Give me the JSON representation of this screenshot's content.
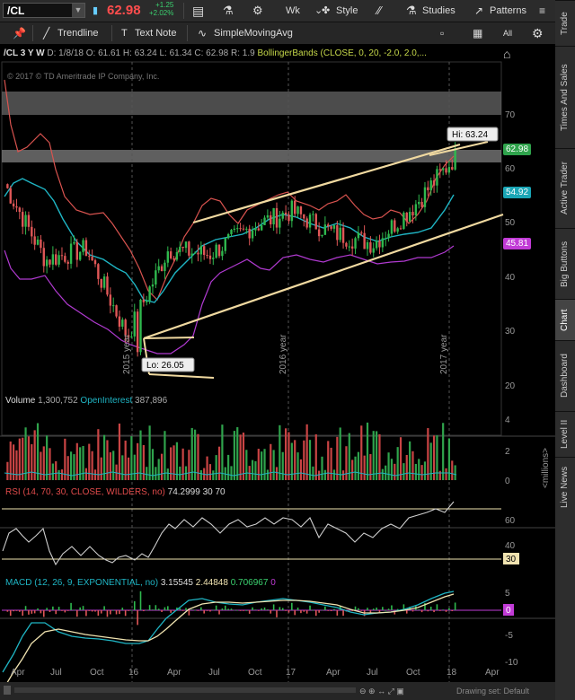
{
  "symbol": "/CL",
  "last_price": "62.98",
  "change": "+1.25",
  "change_pct": "+2.02%",
  "toolbar": {
    "period": "Wk",
    "style": "Style",
    "studies": "Studies",
    "patterns": "Patterns"
  },
  "drawing_tools": {
    "trendline": "Trendline",
    "text_note": "Text Note",
    "sma": "SimpleMovingAvg",
    "all": "All"
  },
  "chart_header": {
    "title": "/CL 3 Y W",
    "d": "D: 1/8/18",
    "o": "O: 61.61",
    "h": "H: 63.24",
    "l": "L: 61.34",
    "c": "C: 62.98",
    "r": "R: 1.9",
    "study": "BollingerBands (CLOSE, 0, 20, -2.0, 2.0,..."
  },
  "copyright": "© 2017 © TD Ameritrade IP Company, Inc.",
  "price_axis": [
    "70",
    "60",
    "50",
    "40",
    "30",
    "20"
  ],
  "price_badges": {
    "last": "62.98",
    "mid": "54.92",
    "lower": "45.81",
    "last_color": "#2fa34c",
    "mid_color": "#1aa5b5",
    "lower_color": "#c13bd6"
  },
  "annotations": {
    "hi": "Hi: 63.24",
    "lo": "Lo: 26.05",
    "year_2015": "2015 year",
    "year_2016": "2016 year",
    "year_2017": "2017 year"
  },
  "volume": {
    "label": "Volume",
    "value": "1,300,752",
    "oi_label": "OpenInterest",
    "oi_value": "387,896",
    "axis": [
      "4",
      "2",
      "0"
    ],
    "units": "<millions>"
  },
  "rsi": {
    "label": "RSI (14, 70, 30, CLOSE, WILDERS, no)",
    "value": "74.2999",
    "p1": "30",
    "p2": "70",
    "axis": [
      "60",
      "40"
    ],
    "badge": "30"
  },
  "macd": {
    "label": "MACD (12, 26, 9, EXPONENTIAL, no)",
    "v1": "3.15545",
    "v2": "2.44848",
    "v3": "0.706967",
    "v4": "0",
    "axis": [
      "5",
      "-5",
      "-10"
    ],
    "badge": "0"
  },
  "time_axis": [
    "Apr",
    "Jul",
    "Oct",
    "16",
    "Apr",
    "Jul",
    "Oct",
    "17",
    "Apr",
    "Jul",
    "Oct",
    "18",
    "Apr"
  ],
  "drawing_set": "Drawing set: Default",
  "side_tabs": [
    "Trade",
    "Times And Sales",
    "Active Trader",
    "Big Buttons",
    "Chart",
    "Dashboard",
    "Level II",
    "Live News"
  ],
  "chart_data": {
    "type": "candlestick",
    "title": "/CL 3 Y W",
    "x": [
      "2015-04",
      "2015-07",
      "2015-10",
      "2016-01",
      "2016-04",
      "2016-07",
      "2016-10",
      "2017-01",
      "2017-04",
      "2017-07",
      "2017-10",
      "2018-01"
    ],
    "close": [
      58,
      44,
      46,
      30,
      46,
      45,
      50,
      53,
      49,
      47,
      54,
      63
    ],
    "ylim": [
      20,
      75
    ],
    "hi": 63.24,
    "lo": 26.05
  }
}
